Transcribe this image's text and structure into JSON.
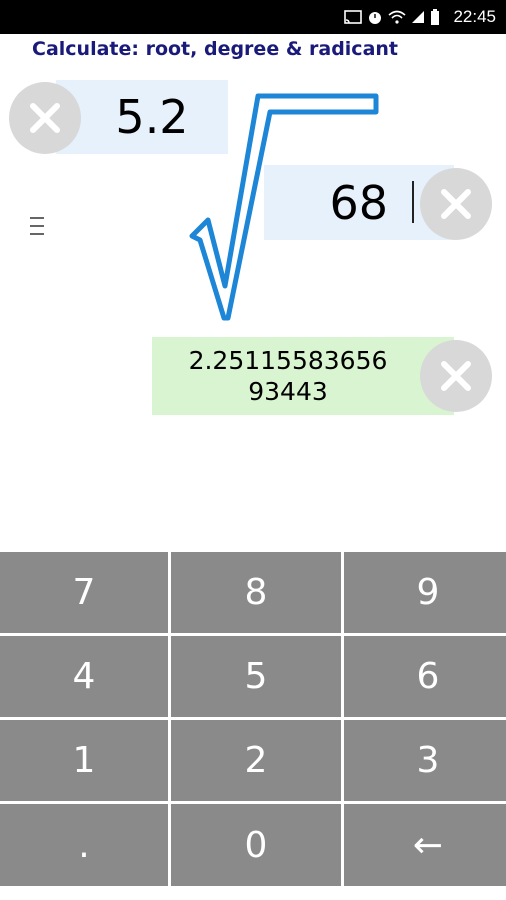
{
  "status_bar": {
    "time": "22:45",
    "icons": [
      "cast-icon",
      "alarm-icon",
      "wifi-icon",
      "signal-icon",
      "battery-icon"
    ]
  },
  "header": {
    "title": "Calculate: root, degree & radicant"
  },
  "degree": {
    "value": "5.2"
  },
  "radicand": {
    "value": "68"
  },
  "result": {
    "line1": "2.25115583656",
    "line2": "93443"
  },
  "keypad": {
    "keys": [
      "7",
      "8",
      "9",
      "4",
      "5",
      "6",
      "1",
      "2",
      "3",
      ".",
      "0",
      "←"
    ]
  },
  "colors": {
    "title": "#1a1a7a",
    "input_bg": "#e6f1fb",
    "result_bg": "#d9f4d0",
    "key_bg": "#8a8a8a",
    "root_sign": "#1e86d6"
  }
}
